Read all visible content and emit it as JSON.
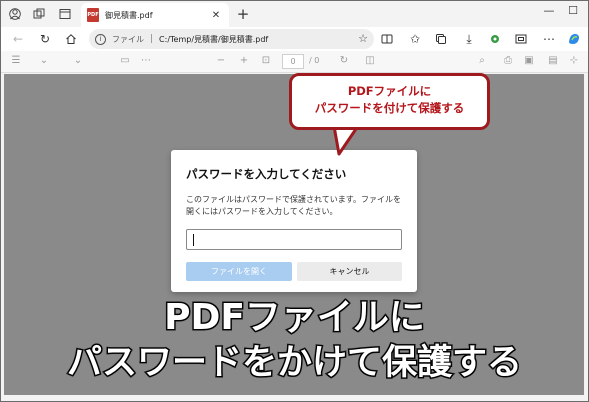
{
  "browser": {
    "tab": {
      "title": "御見積書.pdf",
      "badge": "PDF"
    },
    "address": {
      "label": "ファイル",
      "url": "C:/Temp/見積書/御見積書.pdf"
    }
  },
  "pdf_toolbar": {
    "page_current": "0",
    "page_total": "/ 0"
  },
  "dialog": {
    "title": "パスワードを入力してください",
    "message": "このファイルはパスワードで保護されています。ファイルを開くにはパスワードを入力してください。",
    "password_value": "",
    "open_label": "ファイルを開く",
    "cancel_label": "キャンセル"
  },
  "callout": {
    "line1": "PDFファイルに",
    "line2": "パスワードを付けて保護する"
  },
  "caption": {
    "line1": "PDFファイルに",
    "line2": "パスワードをかけて保護する"
  },
  "colors": {
    "accent": "#b4161b",
    "content_bg": "#8a8a8a",
    "primary_button": "#a9cdf0"
  },
  "icons": [
    "profile-icon",
    "workspaces-icon",
    "tab-actions-icon",
    "close-icon",
    "new-tab-icon",
    "minimize-icon",
    "maximize-icon",
    "back-icon",
    "refresh-icon",
    "home-icon",
    "info-icon",
    "favorite-icon",
    "split-screen-icon",
    "favorites-icon",
    "collections-icon",
    "downloads-icon",
    "extensions-icon",
    "settings-icon",
    "copilot-icon"
  ]
}
